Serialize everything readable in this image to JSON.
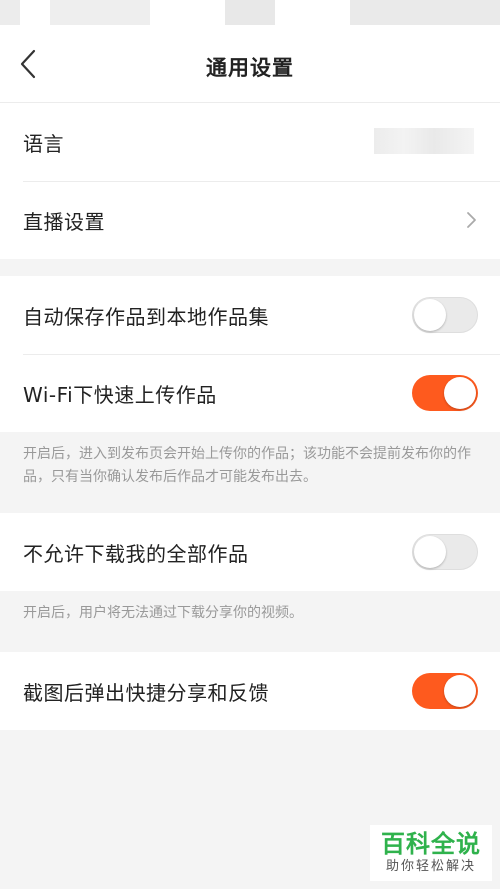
{
  "header": {
    "title": "通用设置",
    "back_icon": "chevron-left-icon"
  },
  "section1": {
    "items": [
      {
        "label": "语言"
      },
      {
        "label": "直播设置",
        "icon": "chevron-right-icon"
      }
    ]
  },
  "section2": {
    "items": [
      {
        "label": "自动保存作品到本地作品集",
        "toggle": "off"
      },
      {
        "label": "Wi-Fi下快速上传作品",
        "toggle": "on"
      }
    ],
    "hint": "开启后，进入到发布页会开始上传你的作品；该功能不会提前发布你的作品，只有当你确认发布后作品才可能发布出去。"
  },
  "section3": {
    "items": [
      {
        "label": "不允许下载我的全部作品",
        "toggle": "off"
      }
    ],
    "hint": "开启后，用户将无法通过下载分享你的视频。"
  },
  "section4": {
    "items": [
      {
        "label": "截图后弹出快捷分享和反馈",
        "toggle": "on"
      }
    ]
  },
  "watermark": {
    "title": "百科全说",
    "subtitle": "助你轻松解决"
  },
  "colors": {
    "toggle_on": "#fe5a1e",
    "toggle_off": "#eaeaea",
    "watermark_green": "#2fb24c"
  }
}
